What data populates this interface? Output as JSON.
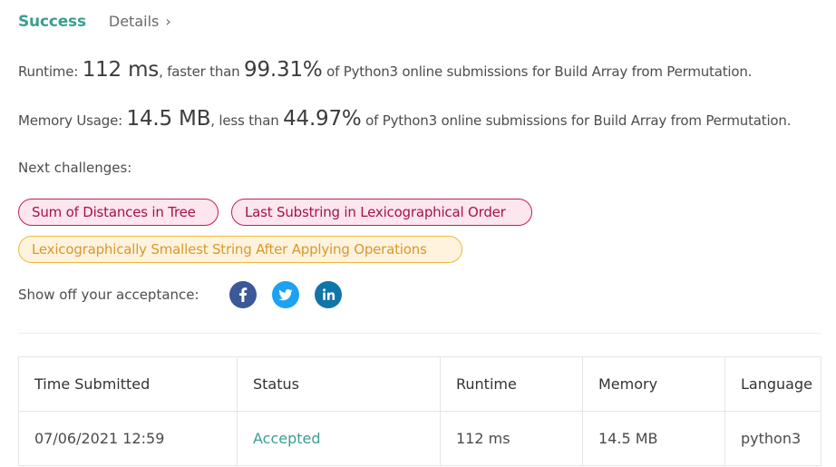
{
  "header": {
    "status": "Success",
    "details_label": "Details",
    "details_chevron": "›"
  },
  "runtime": {
    "label": "Runtime: ",
    "value": "112 ms",
    "comparison": ", faster than ",
    "percent": "99.31%",
    "suffix": " of Python3 online submissions for Build Array from Permutation."
  },
  "memory": {
    "label": "Memory Usage: ",
    "value": "14.5 MB",
    "comparison": ", less than ",
    "percent": "44.97%",
    "suffix": " of Python3 online submissions for Build Array from Permutation."
  },
  "next_challenges": {
    "label": "Next challenges:",
    "items": [
      {
        "label": "Sum of Distances in Tree",
        "difficulty": "hard"
      },
      {
        "label": "Last Substring in Lexicographical Order",
        "difficulty": "hard"
      },
      {
        "label": "Lexicographically Smallest String After Applying Operations",
        "difficulty": "medium"
      }
    ]
  },
  "share": {
    "label": "Show off your acceptance:",
    "networks": [
      {
        "icon": "facebook-icon",
        "color": "#3b5998"
      },
      {
        "icon": "twitter-icon",
        "color": "#1da1f2"
      },
      {
        "icon": "linkedin-icon",
        "color": "#0e76a8"
      }
    ]
  },
  "table": {
    "headers": [
      "Time Submitted",
      "Status",
      "Runtime",
      "Memory",
      "Language"
    ],
    "rows": [
      [
        "07/06/2021 12:59",
        "Accepted",
        "112 ms",
        "14.5 MB",
        "python3"
      ]
    ]
  },
  "colors": {
    "success": "#3b9e8f",
    "hard_border": "#c01e5a",
    "hard_bg": "#fde6ee",
    "medium_border": "#f0b73f",
    "medium_bg": "#fff3de"
  }
}
